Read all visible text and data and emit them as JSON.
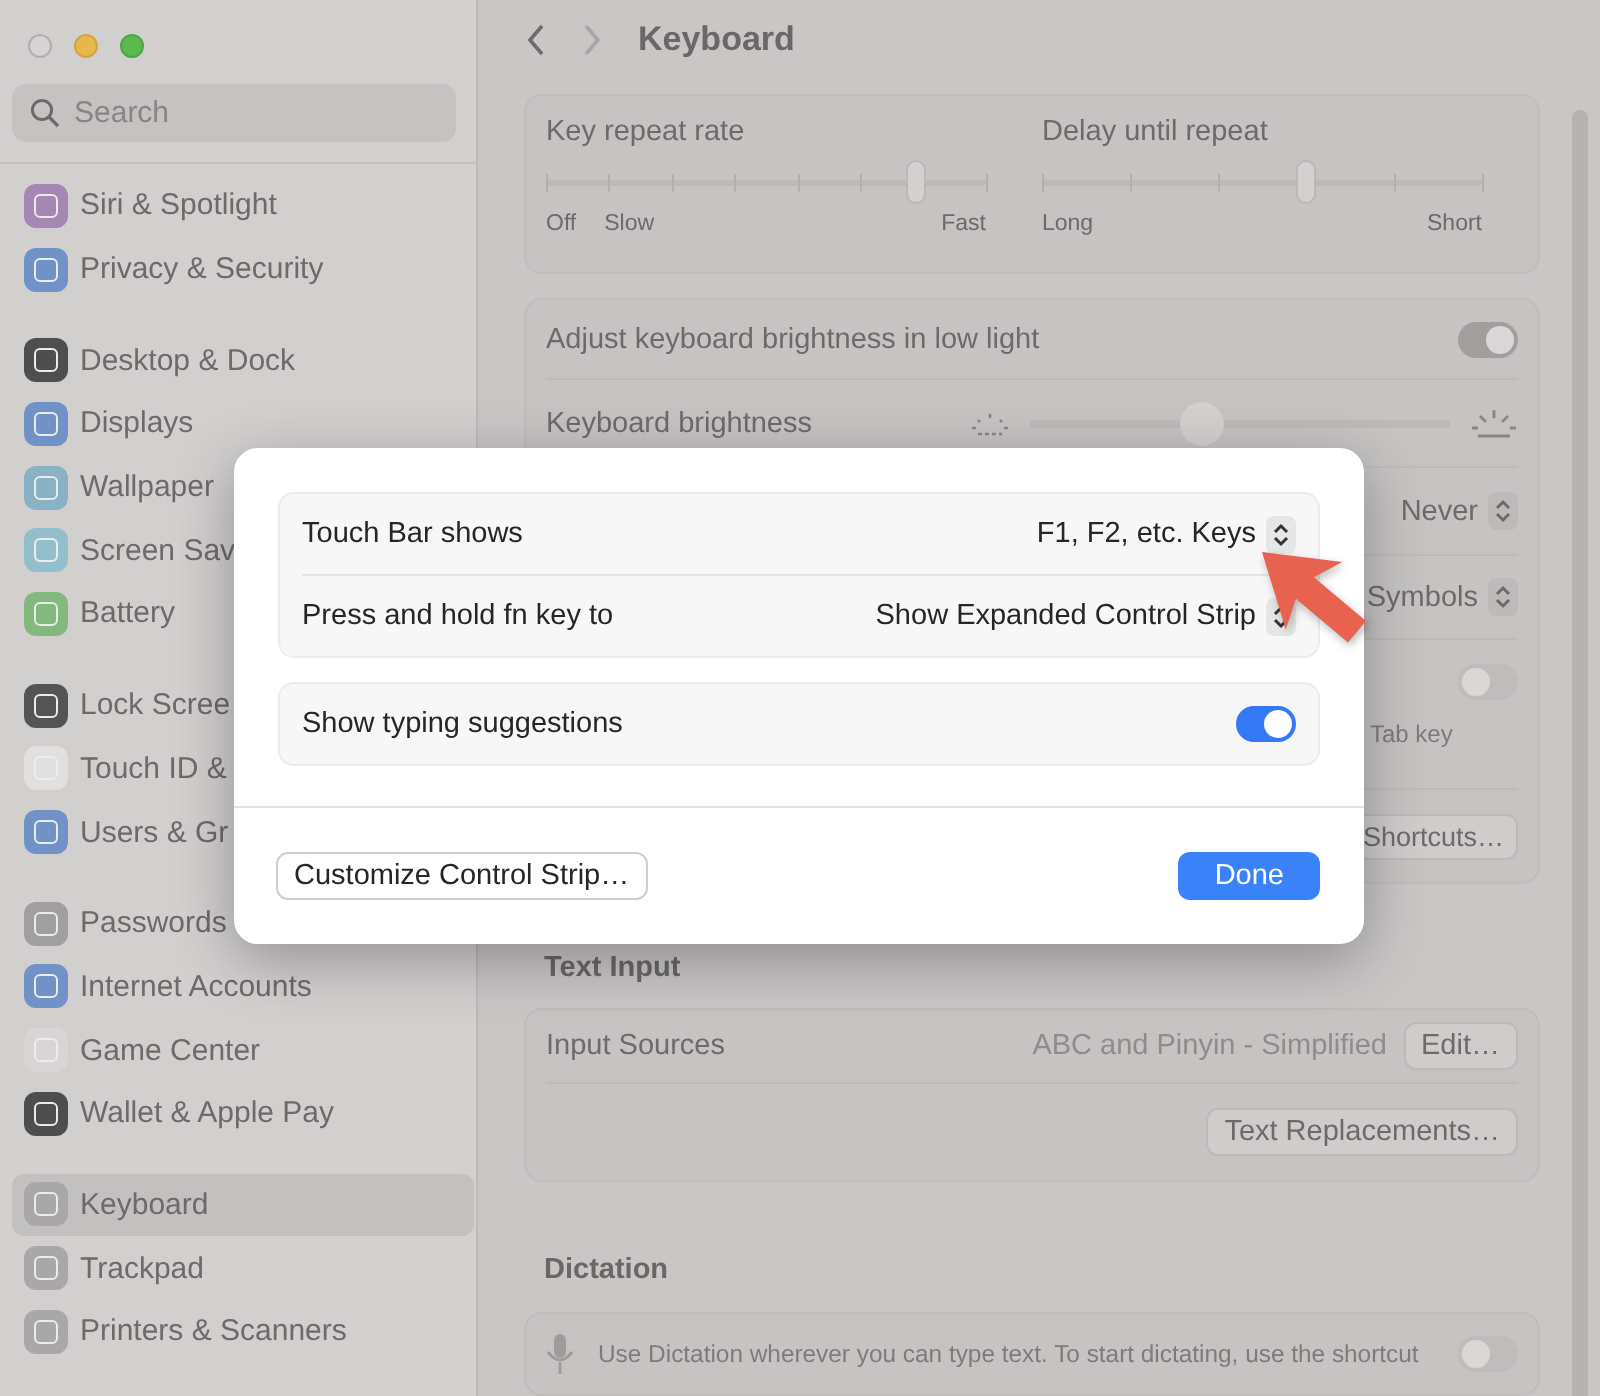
{
  "sidebar": {
    "search": {
      "placeholder": "Search"
    },
    "groups": [
      [
        {
          "label": "Siri & Spotlight",
          "selected": false,
          "color": "#a487b3"
        },
        {
          "label": "Privacy & Security",
          "selected": false,
          "color": "#7192c6"
        }
      ],
      [
        {
          "label": "Desktop & Dock",
          "selected": false,
          "color": "#4f4e4e"
        },
        {
          "label": "Displays",
          "selected": false,
          "color": "#7192c6"
        },
        {
          "label": "Wallpaper",
          "selected": false,
          "color": "#89b2c6"
        },
        {
          "label": "Screen Sav",
          "selected": false,
          "color": "#93bfcd"
        },
        {
          "label": "Battery",
          "selected": false,
          "color": "#83b97d"
        }
      ],
      [
        {
          "label": "Lock Scree",
          "selected": false,
          "color": "#555454"
        },
        {
          "label": "Touch ID &",
          "selected": false,
          "color": "#e2dfdf"
        },
        {
          "label": "Users & Gr",
          "selected": false,
          "color": "#7192c6"
        }
      ],
      [
        {
          "label": "Passwords",
          "selected": false,
          "color": "#a09e9e"
        },
        {
          "label": "Internet Accounts",
          "selected": false,
          "color": "#7192c6"
        },
        {
          "label": "Game Center",
          "selected": false,
          "color": "#d9d5d5"
        },
        {
          "label": "Wallet & Apple Pay",
          "selected": false,
          "color": "#4f4e4e"
        }
      ],
      [
        {
          "label": "Keyboard",
          "selected": true,
          "color": "#a9a7a7"
        },
        {
          "label": "Trackpad",
          "selected": false,
          "color": "#a9a7a7"
        },
        {
          "label": "Printers & Scanners",
          "selected": false,
          "color": "#a9a7a7"
        }
      ]
    ]
  },
  "header": {
    "title": "Keyboard"
  },
  "repeat": {
    "sliders": [
      {
        "title": "Key repeat rate",
        "level": 0.84,
        "labels": [
          "Off",
          "Slow",
          "Fast"
        ]
      },
      {
        "title": "Delay until repeat",
        "level": 0.6,
        "labels": [
          "Long",
          "Short"
        ]
      }
    ]
  },
  "backlight": {
    "rows": [
      {
        "kind": "toggle",
        "label": "Adjust keyboard brightness in low light",
        "on": true
      },
      {
        "kind": "brightness",
        "label": "Keyboard brightness",
        "level": 0.41
      },
      {
        "kind": "popup",
        "value": "Never"
      },
      {
        "kind": "popup",
        "value": "Symbols"
      },
      {
        "kind": "toggle",
        "on": false,
        "description": "Tab key"
      },
      {
        "kind": "button",
        "button": "Shortcuts…"
      }
    ]
  },
  "text_input": {
    "heading": "Text Input",
    "rows": [
      {
        "kind": "value_button",
        "label": "Input Sources",
        "value": "ABC and Pinyin - Simplified",
        "button": "Edit…"
      },
      {
        "kind": "button",
        "button": "Text Replacements…"
      }
    ]
  },
  "dictation": {
    "heading": "Dictation",
    "description": "Use Dictation wherever you can type text. To start dictating, use the shortcut",
    "on": false
  },
  "dialog": {
    "groups": [
      [
        {
          "kind": "popup",
          "label": "Touch Bar shows",
          "value": "F1, F2, etc. Keys"
        },
        {
          "kind": "popup",
          "label": "Press and hold fn key to",
          "value": "Show Expanded Control Strip"
        }
      ],
      [
        {
          "kind": "toggle",
          "label": "Show typing suggestions",
          "on": true
        }
      ]
    ],
    "buttons": [
      {
        "kind": "default",
        "label": "Customize Control Strip…"
      },
      {
        "kind": "primary",
        "label": "Done"
      }
    ]
  }
}
